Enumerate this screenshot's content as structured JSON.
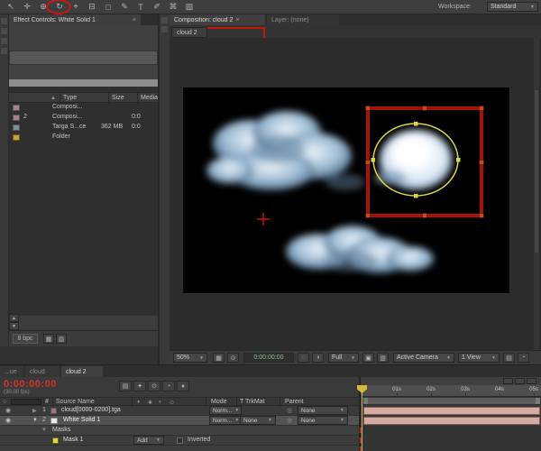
{
  "toolbar": {
    "workspace_label": "Workspace:",
    "workspace_value": "Standard"
  },
  "icons": {
    "selection": "↖",
    "hand": "✛",
    "zoom": "⊕",
    "rotation": "↻",
    "camera": "⌖",
    "pan_behind": "⊟",
    "mask_shape": "□",
    "pen": "✎",
    "type": "T",
    "brush": "✐",
    "clone": "⌘",
    "eraser": "▨",
    "close": "×",
    "dropdown_arrow": "▼",
    "scroll_up": "▲",
    "scroll_down": "▼",
    "sort_up": "▲",
    "search": "○",
    "eye": "◉",
    "twirl_open": "▼",
    "twirl_closed": "▶",
    "pickwhip": "◎",
    "grid": "▦",
    "snapshot": "◌",
    "channels": "◑",
    "roi": "▣",
    "checker": "▥",
    "mini1": "▤",
    "mini2": "✦",
    "mini3": "⊙",
    "mini4": "◔",
    "mini5": "♦",
    "switch1": "♦",
    "switch2": "✱",
    "switch3": "◐",
    "switch4": "⊙",
    "keyframe": "I"
  },
  "effect_controls": {
    "tab_title": "Effect Controls: White Solid 1"
  },
  "project": {
    "columns": {
      "type": "Type",
      "size": "Size",
      "media": "Media D"
    },
    "rows": [
      {
        "name": "",
        "type": "Composi...",
        "size": "",
        "media": ""
      },
      {
        "name": "2",
        "type": "Composi...",
        "size": "",
        "media": "0:0"
      },
      {
        "name": "",
        "type": "Targa S...ce",
        "size": "362 MB",
        "media": "0:0"
      },
      {
        "name": "",
        "type": "Folder",
        "size": "",
        "media": ""
      }
    ],
    "bpc_label": "8 bpc"
  },
  "comp_panel": {
    "tab_active": "Composition: cloud 2",
    "tab_inactive": "Layer: (none)",
    "nav_tab": "cloud 2",
    "zoom": "50%",
    "timecode": "0:00:00:00",
    "resolution": "Full",
    "camera": "Active Camera",
    "view": "1 View"
  },
  "timeline_tabs": [
    "...ue",
    "cloud",
    "cloud 2"
  ],
  "timeline": {
    "timecode": "0:00:00:00",
    "fps": "(30.00 fps)",
    "headers": {
      "hash": "#",
      "source_name": "Source Name",
      "mode": "Mode",
      "trkmat": "T TrkMat",
      "parent": "Parent"
    },
    "layers": [
      {
        "num": "1",
        "name": "cloud[0000-0200].tga",
        "mode": "Norm...",
        "trkmat": "",
        "parent": "None"
      },
      {
        "num": "2",
        "name": "White Solid 1",
        "mode": "Norm...",
        "trkmat": "None",
        "parent": "None"
      }
    ],
    "masks_label": "Masks",
    "mask": {
      "name": "Mask 1",
      "mode": "Add",
      "inverted_label": "Inverted"
    },
    "ruler_labels": [
      "01s",
      "02s",
      "03s",
      "04s",
      "05s"
    ]
  },
  "colors": {
    "annotation_red": "#c41508",
    "mask_yellow": "#dcd83a",
    "layer_bar": "#d6aca2",
    "cti_yellow": "#d8b83c",
    "timecode_red": "#d2342a"
  }
}
